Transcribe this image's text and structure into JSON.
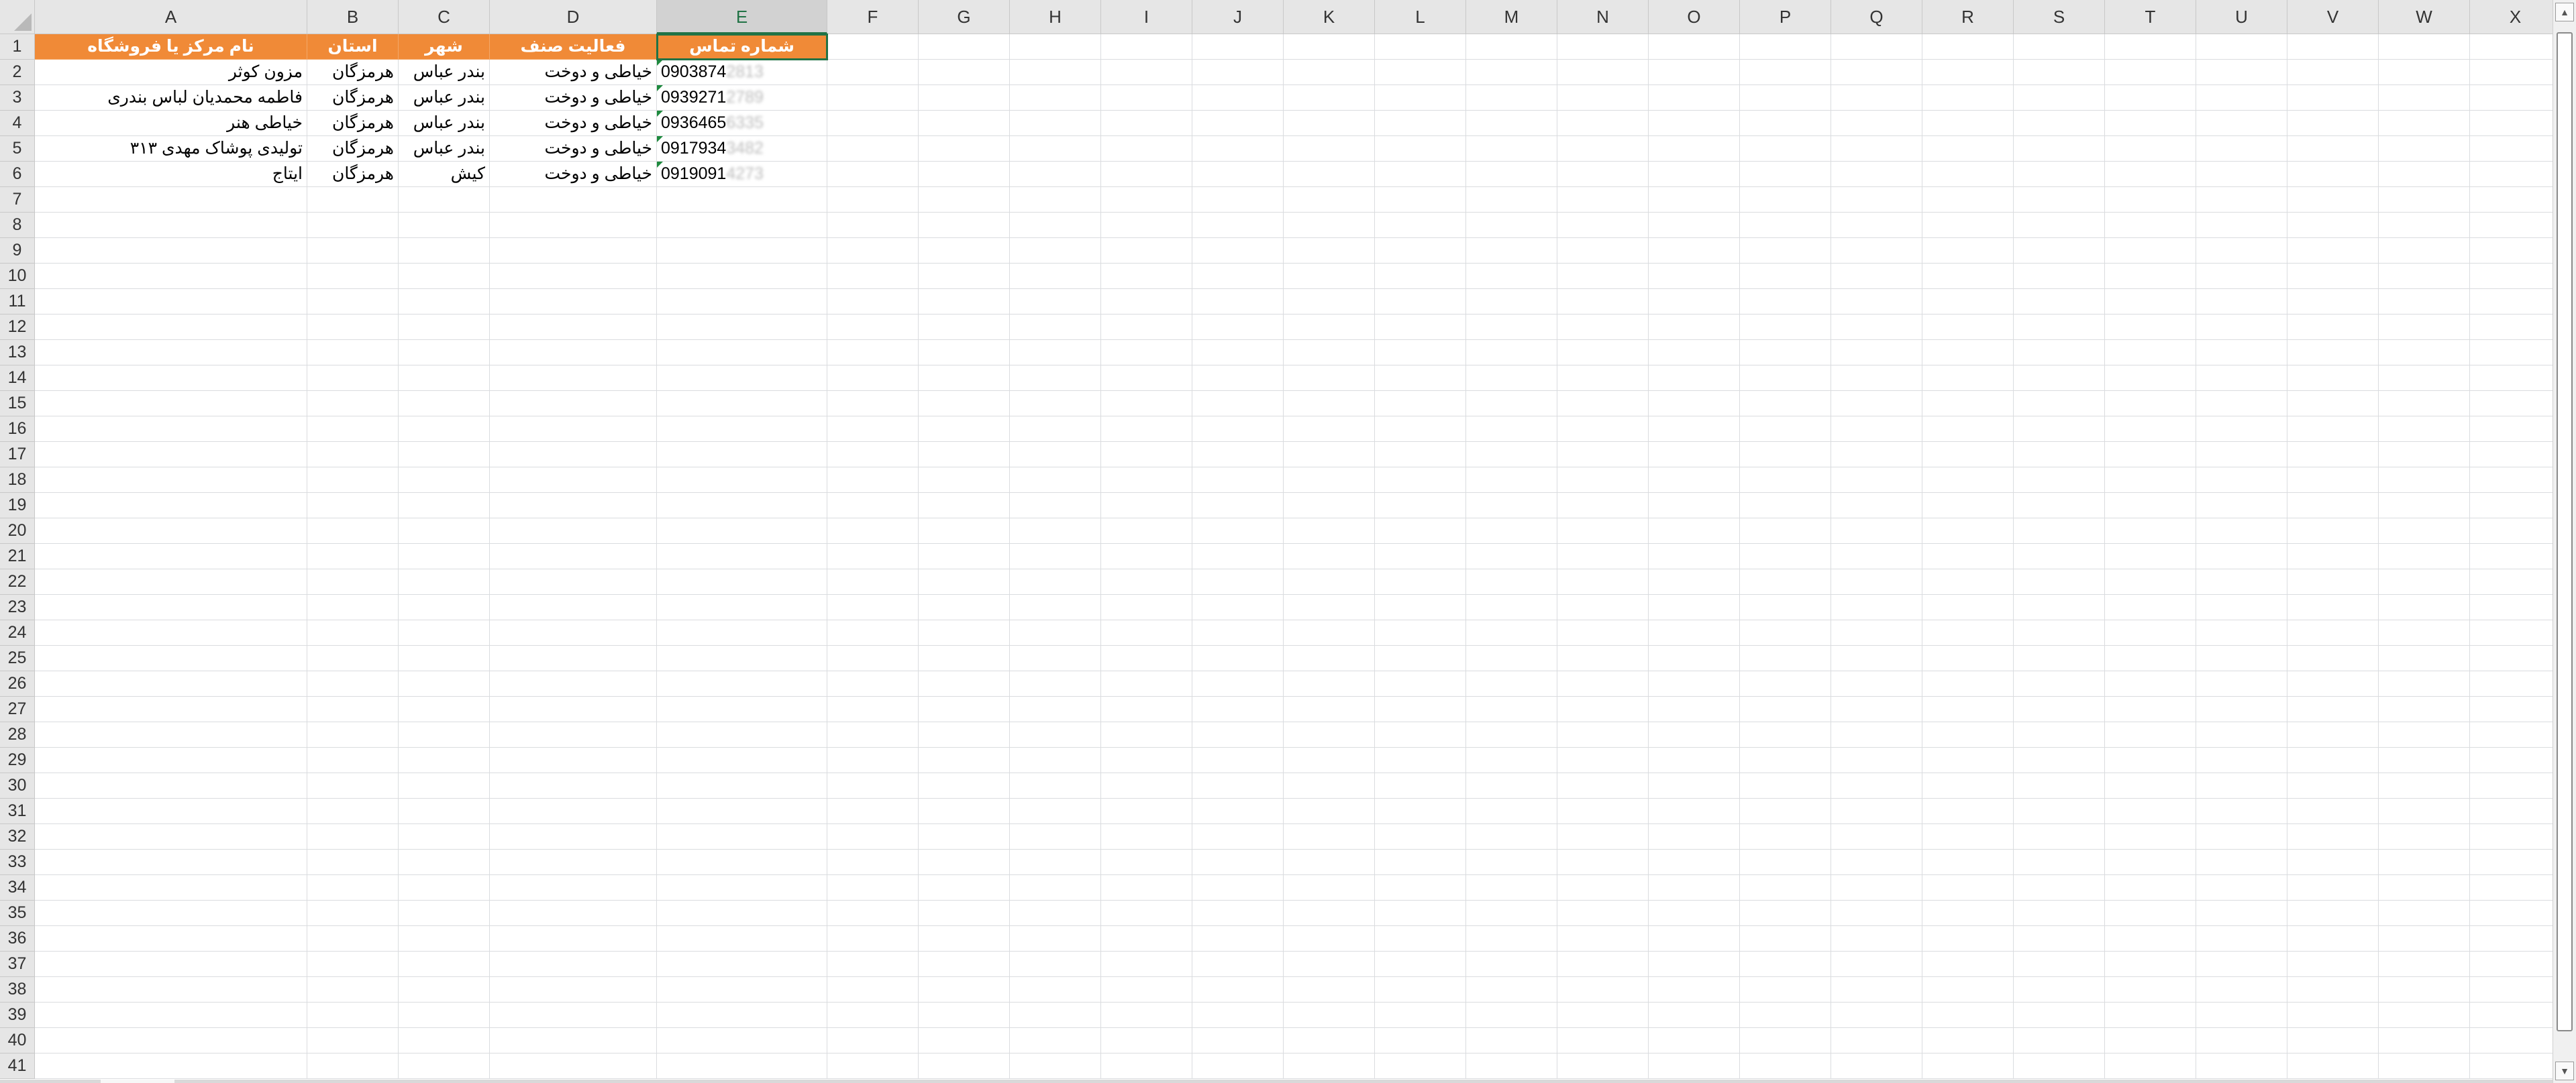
{
  "columns": [
    "A",
    "B",
    "C",
    "D",
    "E",
    "F",
    "G",
    "H",
    "I",
    "J",
    "K",
    "L",
    "M",
    "N",
    "O",
    "P",
    "Q",
    "R",
    "S",
    "T",
    "U",
    "V",
    "W",
    "X"
  ],
  "active_column": "E",
  "rows": [
    "1",
    "2",
    "3",
    "4",
    "5",
    "6",
    "7",
    "8",
    "9",
    "10",
    "11",
    "12",
    "13",
    "14",
    "15",
    "16",
    "17",
    "18",
    "19",
    "20",
    "21",
    "22",
    "23",
    "24",
    "25",
    "26",
    "27",
    "28",
    "29",
    "30",
    "31",
    "32",
    "33",
    "34",
    "35",
    "36",
    "37",
    "38",
    "39",
    "40",
    "41"
  ],
  "header_row": {
    "A": "نام مرکز یا فروشگاه",
    "B": "استان",
    "C": "شهر",
    "D": "فعالیت صنف",
    "E": "شماره تماس"
  },
  "data_rows": [
    {
      "A": "مزون کوثر",
      "B": "هرمزگان",
      "C": "بندر عباس",
      "D": "خیاطی و دوخت",
      "E": "0903874",
      "E_hidden": "2813"
    },
    {
      "A": "فاطمه محمدیان  لباس بندری",
      "B": "هرمزگان",
      "C": "بندر عباس",
      "D": "خیاطی و دوخت",
      "E": "0939271",
      "E_hidden": "2789"
    },
    {
      "A": "خیاطی هنر",
      "B": "هرمزگان",
      "C": "بندر عباس",
      "D": "خیاطی و دوخت",
      "E": "0936465",
      "E_hidden": "6335"
    },
    {
      "A": "تولیدی پوشاک مهدی ۳۱۳",
      "B": "هرمزگان",
      "C": "بندر عباس",
      "D": "خیاطی و دوخت",
      "E": "0917934",
      "E_hidden": "3482"
    },
    {
      "A": "ایتاج",
      "B": "هرمزگان",
      "C": "کیش",
      "D": "خیاطی و دوخت",
      "E": "0919091",
      "E_hidden": "4273"
    }
  ],
  "colors": {
    "header_fill": "#f08a37",
    "header_text": "#ffffff",
    "selection": "#217346",
    "error_indicator": "#1e8a3e"
  },
  "scrollbar": {
    "up_arrow_icon": "▲",
    "down_arrow_icon": "▼"
  }
}
